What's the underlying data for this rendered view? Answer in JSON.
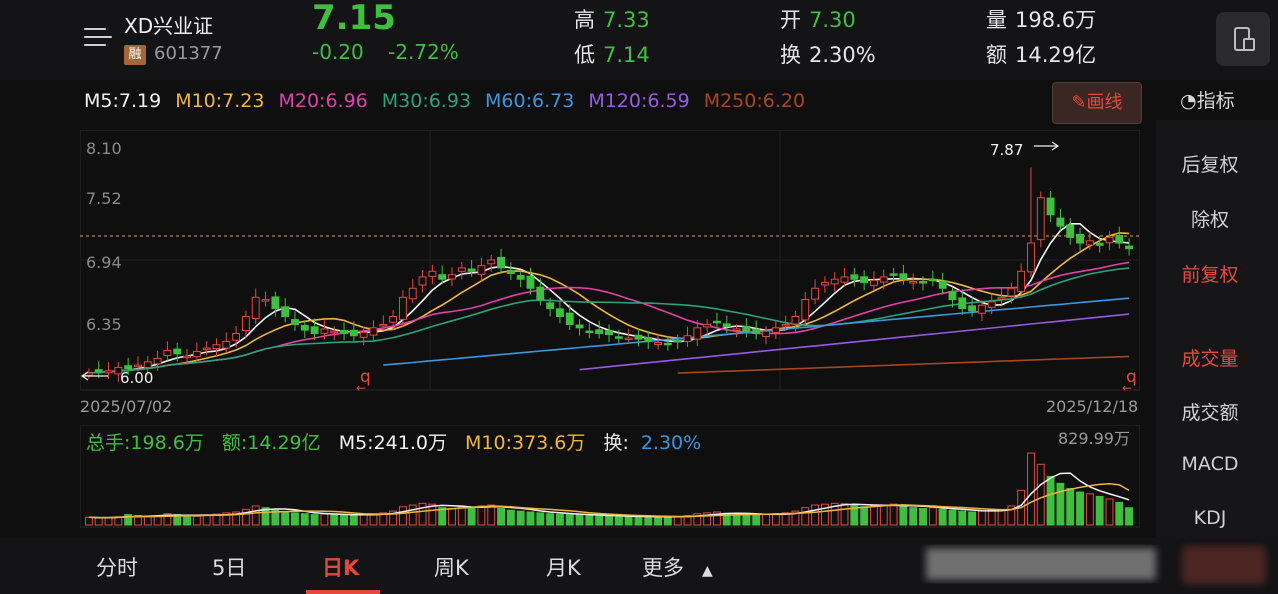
{
  "stock": {
    "name": "XD兴业证",
    "badge": "融",
    "code": "601377",
    "price": "7.15",
    "change": "-0.20",
    "change_pct": "-2.72%",
    "high_label": "高",
    "high": "7.33",
    "low_label": "低",
    "low": "7.14",
    "open_label": "开",
    "open": "7.30",
    "turnover_label": "换",
    "turnover": "2.30%",
    "volume_label": "量",
    "volume": "198.6万",
    "amount_label": "额",
    "amount": "14.29亿"
  },
  "ma": [
    {
      "label": "M5:7.19",
      "color": "#f2f2f2"
    },
    {
      "label": "M10:7.23",
      "color": "#f0b53a"
    },
    {
      "label": "M20:6.96",
      "color": "#e040a8"
    },
    {
      "label": "M30:6.93",
      "color": "#2aa27a"
    },
    {
      "label": "M60:6.73",
      "color": "#3a96e0"
    },
    {
      "label": "M120:6.59",
      "color": "#9a5ae0"
    },
    {
      "label": "M250:6.20",
      "color": "#a8461e"
    }
  ],
  "draw_button": "画线",
  "indicator_tab": "指标",
  "kchart": {
    "y_ticks": [
      "8.10",
      "7.52",
      "6.94",
      "6.35"
    ],
    "low_marker": "6.00",
    "high_marker": "7.87",
    "start_date": "2025/07/02",
    "end_date": "2025/12/18",
    "q_marker": "q"
  },
  "volume": {
    "total_label": "总手:198.6万",
    "amount_label": "额:14.29亿",
    "m5_label": "M5:241.0万",
    "m10_label": "M10:373.6万",
    "turnover_prefix": "换:",
    "turnover_value": "2.30%",
    "max_label": "829.99万"
  },
  "side_panel": [
    "后复权",
    "除权",
    "前复权",
    "成交量",
    "成交额",
    "MACD",
    "KDJ"
  ],
  "tabs": [
    "分时",
    "5日",
    "日K",
    "周K",
    "月K",
    "更多"
  ],
  "active_tab": "日K",
  "colors": {
    "up": "#e5483b",
    "down": "#3fbf3f",
    "background": "#0f0f10"
  },
  "chart_data": {
    "type": "candlestick",
    "x_range": [
      "2025/07/02",
      "2025/12/18"
    ],
    "ylim": [
      5.9,
      8.2
    ],
    "y_ticks": [
      8.1,
      7.52,
      6.94,
      6.35
    ],
    "period_high": 7.87,
    "period_low": 6.0,
    "last_close": 7.15,
    "closes": [
      6.05,
      6.06,
      6.07,
      6.1,
      6.09,
      6.12,
      6.15,
      6.18,
      6.25,
      6.22,
      6.2,
      6.24,
      6.27,
      6.3,
      6.33,
      6.4,
      6.55,
      6.72,
      6.7,
      6.62,
      6.55,
      6.48,
      6.43,
      6.4,
      6.44,
      6.42,
      6.4,
      6.38,
      6.41,
      6.45,
      6.48,
      6.55,
      6.72,
      6.8,
      6.9,
      6.95,
      6.88,
      6.92,
      6.98,
      6.95,
      7.0,
      7.05,
      6.98,
      6.93,
      6.88,
      6.8,
      6.7,
      6.62,
      6.55,
      6.48,
      6.45,
      6.42,
      6.4,
      6.39,
      6.37,
      6.36,
      6.35,
      6.33,
      6.32,
      6.31,
      6.33,
      6.38,
      6.45,
      6.48,
      6.5,
      6.46,
      6.44,
      6.42,
      6.4,
      6.42,
      6.45,
      6.48,
      6.55,
      6.7,
      6.8,
      6.85,
      6.88,
      6.9,
      6.88,
      6.85,
      6.87,
      6.9,
      6.92,
      6.88,
      6.86,
      6.85,
      6.87,
      6.8,
      6.7,
      6.62,
      6.6,
      6.65,
      6.68,
      6.72,
      6.8,
      6.95,
      7.2,
      7.6,
      7.45,
      7.35,
      7.25,
      7.2,
      7.22,
      7.18,
      7.25,
      7.2,
      7.15
    ],
    "volume_unit": "万",
    "volume_max": 829.99,
    "volumes": [
      90,
      80,
      85,
      95,
      120,
      110,
      100,
      105,
      130,
      120,
      110,
      100,
      115,
      125,
      140,
      150,
      180,
      220,
      200,
      170,
      150,
      140,
      130,
      120,
      125,
      120,
      115,
      110,
      120,
      130,
      140,
      160,
      210,
      230,
      250,
      240,
      200,
      190,
      210,
      200,
      220,
      230,
      190,
      170,
      160,
      150,
      140,
      130,
      125,
      120,
      115,
      110,
      105,
      100,
      100,
      98,
      95,
      95,
      93,
      92,
      95,
      110,
      130,
      140,
      150,
      135,
      125,
      120,
      115,
      120,
      130,
      140,
      160,
      200,
      230,
      240,
      250,
      245,
      230,
      210,
      220,
      230,
      240,
      220,
      200,
      190,
      200,
      185,
      170,
      160,
      150,
      160,
      170,
      180,
      220,
      400,
      830,
      700,
      560,
      480,
      420,
      380,
      360,
      330,
      300,
      260,
      198.6
    ]
  }
}
